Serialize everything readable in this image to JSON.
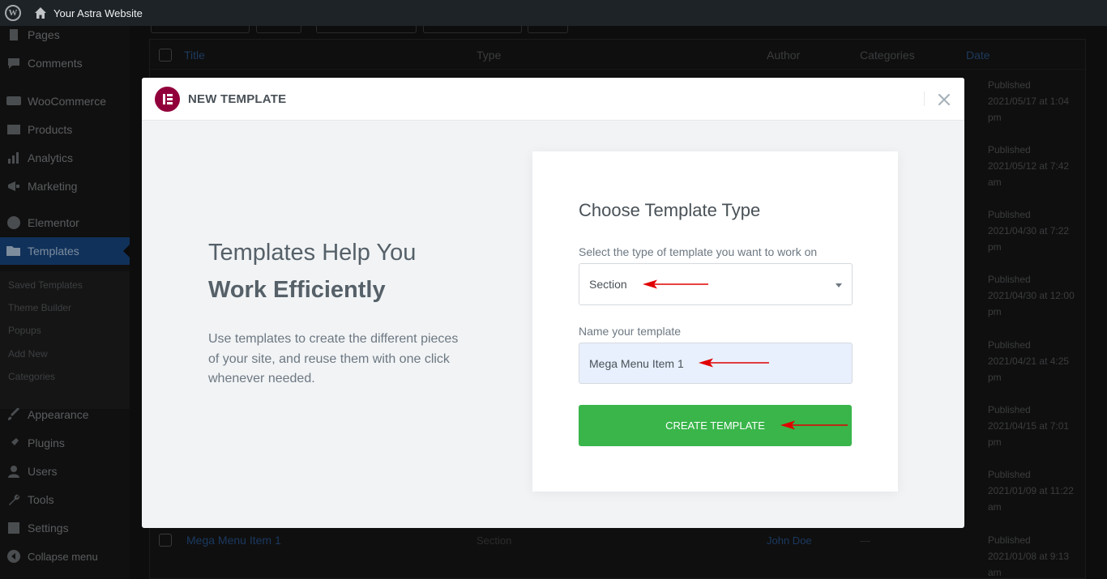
{
  "adminbar": {
    "site_name": "Your Astra Website",
    "logo_letter": "W"
  },
  "sidebar": {
    "items": [
      {
        "label": "Pages",
        "icon": "pages-icon"
      },
      {
        "label": "Comments",
        "icon": "comments-icon"
      },
      {
        "label": "WooCommerce",
        "icon": "woocommerce-icon"
      },
      {
        "label": "Products",
        "icon": "products-icon"
      },
      {
        "label": "Analytics",
        "icon": "analytics-icon"
      },
      {
        "label": "Marketing",
        "icon": "marketing-icon"
      },
      {
        "label": "Elementor",
        "icon": "elementor-icon"
      },
      {
        "label": "Templates",
        "icon": "folder-icon",
        "active": true
      },
      {
        "label": "Appearance",
        "icon": "brush-icon"
      },
      {
        "label": "Plugins",
        "icon": "plug-icon"
      },
      {
        "label": "Users",
        "icon": "user-icon"
      },
      {
        "label": "Tools",
        "icon": "wrench-icon"
      },
      {
        "label": "Settings",
        "icon": "settings-icon"
      },
      {
        "label": "Collapse menu",
        "icon": "collapse-icon"
      }
    ],
    "submenu": [
      "Saved Templates",
      "Theme Builder",
      "Popups",
      "Add New",
      "Categories"
    ]
  },
  "table": {
    "headers": {
      "title": "Title",
      "type": "Type",
      "author": "Author",
      "categories": "Categories",
      "date": "Date"
    },
    "rows": [
      {
        "status": "Published",
        "date": "2021/05/17 at 1:04 pm"
      },
      {
        "status": "Published",
        "date": "2021/05/12 at 7:42 am"
      },
      {
        "status": "Published",
        "date": "2021/04/30 at 7:22 pm"
      },
      {
        "status": "Published",
        "date": "2021/04/30 at 12:00 pm"
      },
      {
        "status": "Published",
        "date": "2021/04/21 at 4:25 pm"
      },
      {
        "status": "Published",
        "date": "2021/04/15 at 7:01 pm"
      },
      {
        "status": "Published",
        "date": "2021/01/09 at 11:22 am"
      },
      {
        "status": "Published",
        "date": "2021/01/08 at 9:13 am",
        "title": "Mega Menu Item 1",
        "type": "Section",
        "author": "John Doe",
        "categories": "—"
      }
    ]
  },
  "modal": {
    "title": "NEW TEMPLATE",
    "intro_heading_line1": "Templates Help You",
    "intro_heading_line2": "Work Efficiently",
    "intro_text": "Use templates to create the different pieces of your site, and reuse them with one click whenever needed.",
    "card_title": "Choose Template Type",
    "select_label": "Select the type of template you want to work on",
    "select_value": "Section",
    "name_label": "Name your template",
    "name_value": "Mega Menu Item 1",
    "create_button": "CREATE TEMPLATE"
  },
  "colors": {
    "elementor_brand": "#92003b",
    "create_button": "#39b54a",
    "annotation_arrow": "#e00000",
    "input_autofill": "#e8f0fe"
  }
}
